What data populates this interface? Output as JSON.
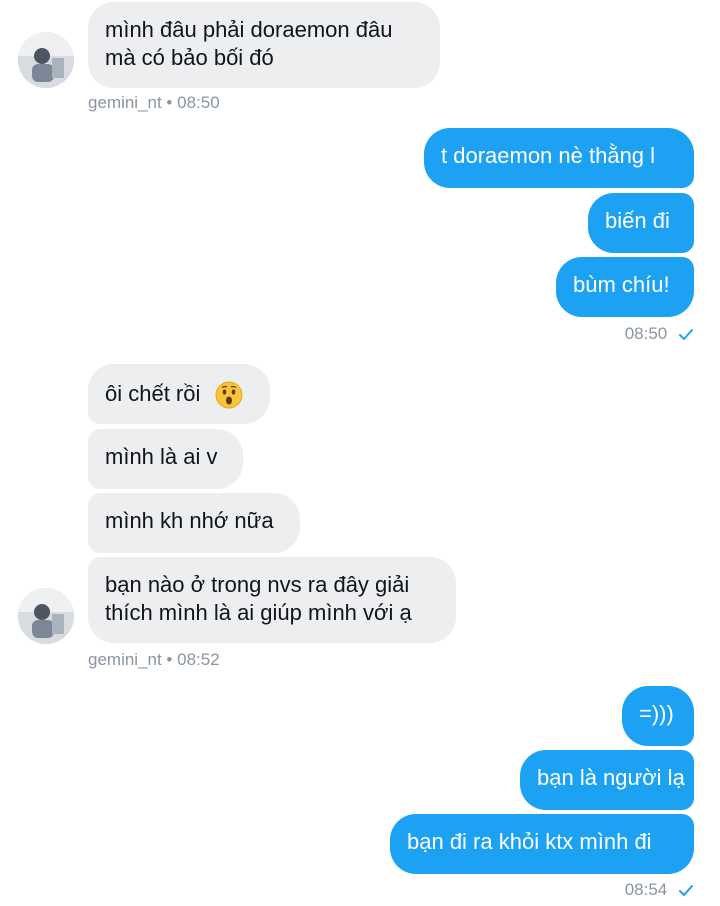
{
  "messages": [
    {
      "text": "mình đâu phải doraemon đâu",
      "text2": "mà có bảo bối đó"
    },
    {
      "text": "t doraemon nè thằng l"
    },
    {
      "text": "biến đi"
    },
    {
      "text": "bùm chíu!"
    },
    {
      "text": "ôi chết rồi"
    },
    {
      "text": "mình là ai v"
    },
    {
      "text": "mình kh nhớ nữa"
    },
    {
      "text": "bạn nào ở trong nvs ra đây giải",
      "text2": "thích mình là ai giúp mình với ạ"
    },
    {
      "text": "=)))"
    },
    {
      "text": "bạn là người lạ"
    },
    {
      "text": "bạn đi ra khỏi ktx mình đi"
    }
  ],
  "meta": {
    "m1": "gemini_nt • 08:50",
    "m2": "08:50",
    "m3": "gemini_nt • 08:52",
    "m4": "08:54"
  },
  "icons": {
    "check": "read-check-icon",
    "emoji": "hushed-face-emoji"
  },
  "colors": {
    "outgoing": "#1da1f2",
    "incoming": "#edeef0",
    "meta": "#8a95a0"
  }
}
